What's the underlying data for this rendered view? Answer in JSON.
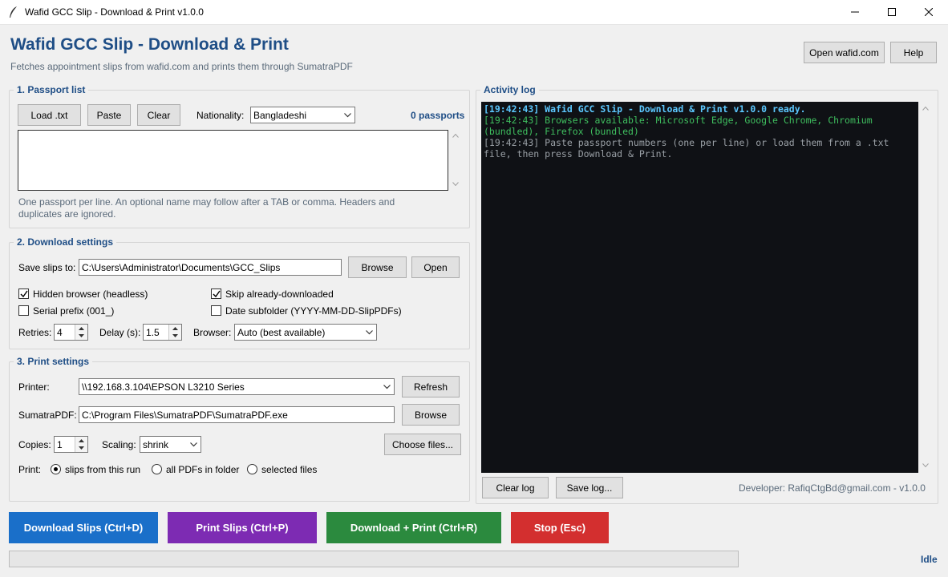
{
  "window": {
    "title": "Wafid GCC Slip - Download & Print  v1.0.0"
  },
  "header": {
    "title": "Wafid GCC Slip  -  Download & Print",
    "subtitle": "Fetches appointment slips from wafid.com and prints them through SumatraPDF",
    "open_site_label": "Open wafid.com",
    "help_label": "Help"
  },
  "passport": {
    "section_title": "1.  Passport list",
    "load_label": "Load .txt",
    "paste_label": "Paste",
    "clear_label": "Clear",
    "nationality_label": "Nationality:",
    "nationality_value": "Bangladeshi",
    "count_text": "0 passports",
    "hint": "One passport per line.  An optional name may follow after a TAB or comma.  Headers and duplicates are ignored."
  },
  "download": {
    "section_title": "2.  Download settings",
    "save_label": "Save slips to:",
    "save_path": "C:\\Users\\Administrator\\Documents\\GCC_Slips",
    "browse_label": "Browse",
    "open_label": "Open",
    "hidden_browser_label": "Hidden browser (headless)",
    "hidden_browser_checked": true,
    "skip_label": "Skip already-downloaded",
    "skip_checked": true,
    "serial_label": "Serial prefix (001_)",
    "serial_checked": false,
    "date_label": "Date subfolder (YYYY-MM-DD-SlipPDFs)",
    "date_checked": false,
    "retries_label": "Retries:",
    "retries_value": "4",
    "delay_label": "Delay (s):",
    "delay_value": "1.5",
    "browser_label": "Browser:",
    "browser_value": "Auto (best available)"
  },
  "print": {
    "section_title": "3.  Print settings",
    "printer_label": "Printer:",
    "printer_value": "\\\\192.168.3.104\\EPSON L3210 Series",
    "refresh_label": "Refresh",
    "sumatra_label": "SumatraPDF:",
    "sumatra_path": "C:\\Program Files\\SumatraPDF\\SumatraPDF.exe",
    "browse_label": "Browse",
    "copies_label": "Copies:",
    "copies_value": "1",
    "scaling_label": "Scaling:",
    "scaling_value": "shrink",
    "choose_files_label": "Choose files...",
    "print_label": "Print:",
    "opt_run": "slips from this run",
    "opt_all": "all PDFs in folder",
    "opt_selected": "selected files",
    "selected_option": "slips from this run"
  },
  "activity": {
    "title": "Activity log",
    "lines": [
      {
        "style": "ready",
        "text": "[19:42:43] Wafid GCC Slip - Download & Print v1.0.0 ready."
      },
      {
        "style": "green",
        "text": "[19:42:43] Browsers available: Microsoft Edge, Google Chrome, Chromium (bundled), Firefox (bundled)"
      },
      {
        "style": "gray",
        "text": "[19:42:43] Paste passport numbers (one per line) or load them from a .txt file, then press Download & Print."
      }
    ],
    "clear_log_label": "Clear log",
    "save_log_label": "Save log...",
    "developer_text": "Developer: RafiqCtgBd@gmail.com   -   v1.0.0"
  },
  "actions": {
    "download_label": "Download Slips  (Ctrl+D)",
    "download_color": "#1a6fc9",
    "print_label": "Print Slips  (Ctrl+P)",
    "print_color": "#7d2bb3",
    "download_print_label": "Download + Print  (Ctrl+R)",
    "download_print_color": "#2b8a3e",
    "stop_label": "Stop  (Esc)",
    "stop_color": "#d32f2f"
  },
  "status": {
    "progress": 0,
    "state_text": "Idle"
  }
}
